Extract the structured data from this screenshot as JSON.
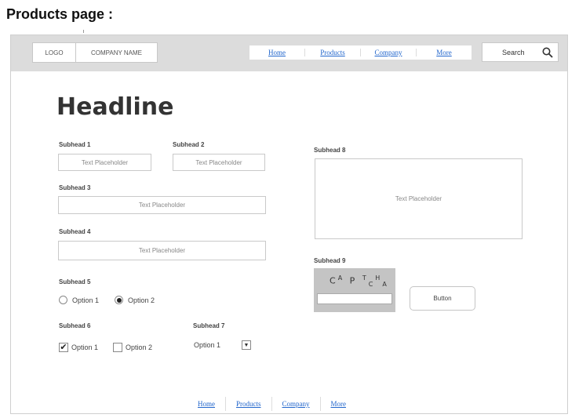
{
  "page_caption": "Products page :",
  "header": {
    "logo": "LOGO",
    "company_name": "COMPANY NAME",
    "nav": [
      "Home",
      "Products",
      "Company",
      "More"
    ],
    "search_label": "Search"
  },
  "headline": "Headline",
  "form": {
    "subhead1": "Subhead 1",
    "subhead2": "Subhead 2",
    "subhead3": "Subhead 3",
    "subhead4": "Subhead 4",
    "subhead5": "Subhead 5",
    "subhead6": "Subhead 6",
    "subhead7": "Subhead 7",
    "subhead8": "Subhead 8",
    "subhead9": "Subhead 9",
    "placeholder": "Text Placeholder",
    "radio_options": [
      "Option 1",
      "Option 2"
    ],
    "radio_selected": "Option 2",
    "check_options": [
      "Option 1",
      "Option 2"
    ],
    "check_selected": [
      "Option 1"
    ],
    "select_value": "Option 1",
    "captcha_text": "CAPTCHA",
    "button_label": "Button"
  },
  "footer": {
    "links": [
      "Home",
      "Products",
      "Company",
      "More"
    ]
  },
  "colors": {
    "link": "#2266cc",
    "topbar_bg": "#dcdcdc",
    "captcha_bg": "#c4c4c4"
  },
  "icons": {
    "search": "search-icon",
    "radio_selected": "radio-selected-icon",
    "checkbox_checked": "checkmark-icon",
    "select": "dropdown-arrow-icon"
  }
}
